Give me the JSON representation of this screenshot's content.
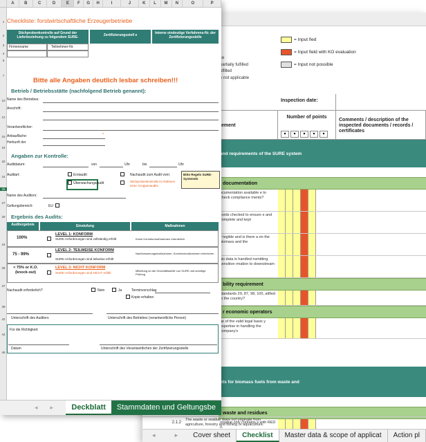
{
  "back": {
    "legend": [
      {
        "label": "= Input fied",
        "color": "#ffff99"
      },
      {
        "label": "= Input field with KO evaluation",
        "color": "#e8542a"
      },
      {
        "label": "= Input not possible",
        "color": "#e0e0e0"
      }
    ],
    "left_legend": [
      "ce",
      "partially fulfilled",
      "ulfilled",
      "e not applicable"
    ],
    "inspection_date": "Inspection date:",
    "number_of_points": "Number of points",
    "comments_header": "Comments / description of the inspected documents / records / certificates",
    "requirement_header": "ement",
    "band1": "and requirements of the SURE system",
    "section_doc": "documentation",
    "rows_doc": [
      "ocumentation available e to check compliance ments?",
      "cords checked to ensure e and complete and kept",
      "y legible and is there a en the biomass and the",
      "his data is handled nsmitting sensitive rmation to downstream"
    ],
    "section_ability": "bility requirement",
    "row_ability": "standards 29, 87, 98, 100, atified in the country?",
    "section_econ": "r economic operators",
    "row_econ": "ge of the valid legal basis y expertise in handling the company's",
    "band2": "nts for biomass fuels from waste and",
    "section_waste": "waste and residues",
    "row_waste1": "residue only contains s with RED II.",
    "row_num": "2.1.2",
    "row_waste2": "The waste or residue does not originate from agriculture, forestry and fishing or aquaculture.",
    "tabs": [
      "Cover sheet",
      "Checklist",
      "Master data & scope of applicat",
      "Action pl"
    ],
    "active_tab": "Checklist"
  },
  "front": {
    "columns": [
      "A",
      "B",
      "C",
      "D",
      "E",
      "F",
      "G",
      "H",
      "I",
      "J",
      "K",
      "L",
      "M",
      "N",
      "O",
      "P"
    ],
    "title": "Checkliste: forstwirtschaftliche Erzeugerbetriebe",
    "hdr1": "Stichprobenkontrolle auf Grund der Lieferbeziehung zu folgendem SURE-",
    "hdr2": "Zertifizierungsstell e",
    "hdr3": "Interne eindeutige Verfahrens-Nr. der Zertifizierungsstelle",
    "firmenname": "Firmenname",
    "teilnehmer": "Teilnehmer-Nr.",
    "notice": "Bitte alle Angaben deutlich lesbar schreiben!!!",
    "betrieb_title": "Betrieb / Betriebsstätte (nachfolgend Betrieb genannt):",
    "fields": [
      "Name des Betriebes:",
      "Anschrift:",
      "Verantwortlicher:",
      "Anbaufläche:",
      "Herkunft der"
    ],
    "kontrolle_title": "Angaben zur Kontrolle:",
    "auditdatum": "Auditdatum:",
    "von": "von",
    "uhr1": "Uhr",
    "bis": "bis",
    "uhr2": "Uhr",
    "auditart": "Auditart:",
    "erstaudit": "Erstaudit",
    "ueberwachung": "Überwachungsaudit",
    "nachaudit": "Nachaudit zum Audit vom:",
    "stichprobe": "Stichprobenkontrolle im Rahmen einer Gruppenaudits",
    "sure_box": "Bitte Regeln SURE-Systemdo",
    "auditor": "Name des Auditors:",
    "geltung": "Geltungsbereich:",
    "eu": "EU",
    "ergebnis_title": "Ergebnis des Audits:",
    "result_headers": [
      "Auditergebnis",
      "Einstufung",
      "Maßnahmen"
    ],
    "results": [
      {
        "score": "100%",
        "level": "LEVEL 1: KONFORM",
        "desc": "SURE-Anforderungen sind vollständig erfüllt",
        "measure": "Keine Korrekturmaßnahmen erforderlich"
      },
      {
        "score": "75 - 99%",
        "level": "LEVEL 2: TEILWEISE KONFORM",
        "desc": "SURE-Anforderungen sind teilweise erfüllt",
        "measure": "Nachbesserungsmaßnahmen, Korrekturmaßnahmen einreichen"
      },
      {
        "score": "< 75% or K.O. (knock-out)",
        "level": "LEVEL 3: NICHT KONFORM",
        "desc": "SURE-Anforderungen sind NICHT erfüllt",
        "measure": "Mitteilung an die Geschäftsstelle von SURE und sofortige Prüfung"
      }
    ],
    "nachaudit_q": "Nachaudit erforderlich?",
    "nein": "Nein",
    "ja": "Ja",
    "termin": "Terminvorschlag",
    "kopie": "Kopie erhalten",
    "sig_auditor": "Unterschrift des Auditors",
    "sig_betrieb": "Unterschrift des Betriebes (verantwortliche Person)",
    "richtigkeit": "Für die Richtigkeit:",
    "datum": "Datum",
    "sig_zert": "Unterschrift des Verantwortlichen der Zertifizierungsstelle",
    "tabs": [
      "Deckblatt",
      "Stammdaten und Geltungsbe"
    ],
    "active_tab": "Deckblatt"
  }
}
